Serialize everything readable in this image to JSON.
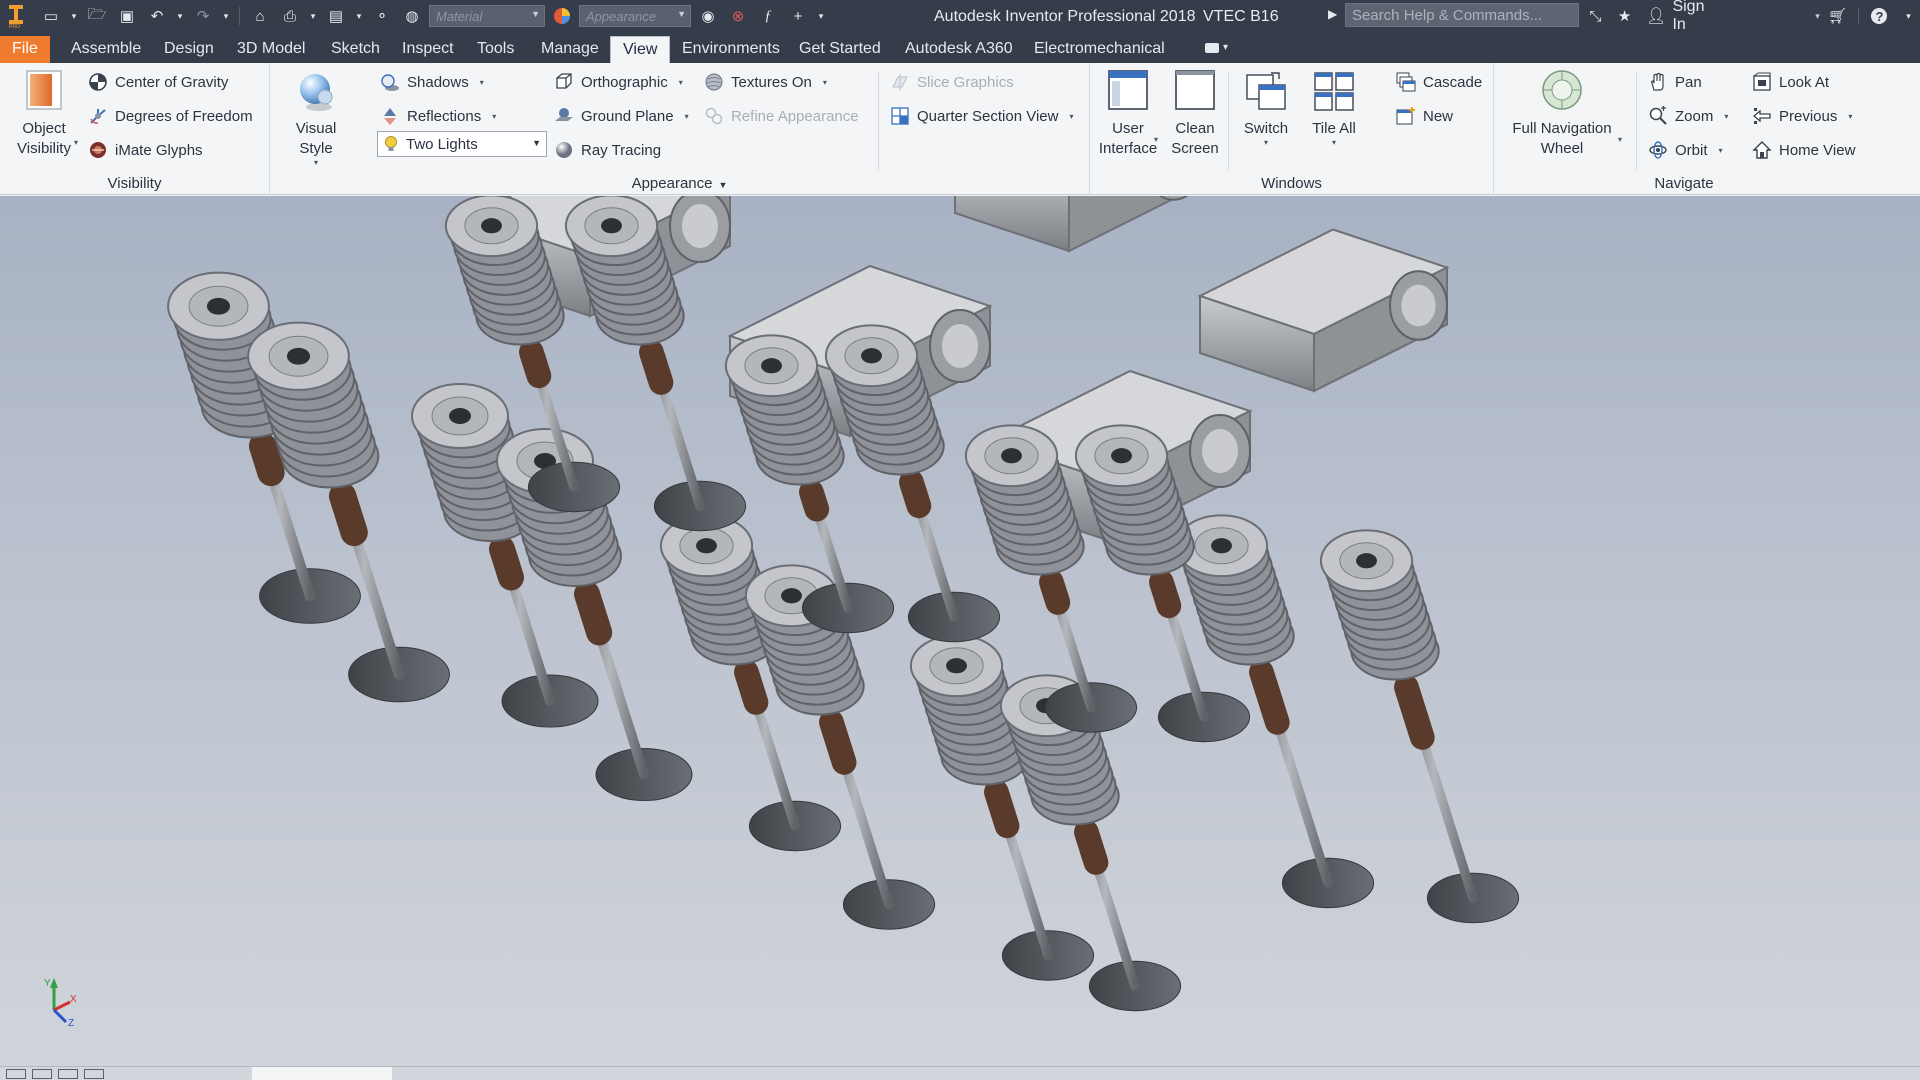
{
  "window": {
    "app_title": "Autodesk Inventor Professional 2018",
    "document_title": "VTEC B16",
    "search_placeholder": "Search Help & Commands...",
    "sign_in": "Sign In"
  },
  "qat": {
    "material_placeholder": "Material",
    "appearance_placeholder": "Appearance"
  },
  "tabs": [
    {
      "label": "File"
    },
    {
      "label": "Assemble"
    },
    {
      "label": "Design"
    },
    {
      "label": "3D Model"
    },
    {
      "label": "Sketch"
    },
    {
      "label": "Inspect"
    },
    {
      "label": "Tools"
    },
    {
      "label": "Manage"
    },
    {
      "label": "View"
    },
    {
      "label": "Environments"
    },
    {
      "label": "Get Started"
    },
    {
      "label": "Autodesk A360"
    },
    {
      "label": "Electromechanical"
    }
  ],
  "ribbon": {
    "visibility": {
      "title": "Visibility",
      "object_visibility": "Object Visibility",
      "center_of_gravity": "Center of Gravity",
      "degrees_of_freedom": "Degrees of Freedom",
      "imate_glyphs": "iMate Glyphs"
    },
    "appearance": {
      "title": "Appearance",
      "visual_style": "Visual Style",
      "shadows": "Shadows",
      "reflections": "Reflections",
      "lighting": "Two Lights",
      "orthographic": "Orthographic",
      "ground_plane": "Ground Plane",
      "ray_tracing": "Ray Tracing",
      "textures_on": "Textures On",
      "refine_appearance": "Refine Appearance",
      "slice_graphics": "Slice Graphics",
      "quarter_section_view": "Quarter Section View"
    },
    "windows": {
      "title": "Windows",
      "user_interface": "User Interface",
      "clean_screen": "Clean Screen",
      "switch": "Switch",
      "tile_all": "Tile All",
      "cascade": "Cascade",
      "new": "New"
    },
    "navigate": {
      "title": "Navigate",
      "full_navigation_wheel": "Full Navigation Wheel",
      "pan": "Pan",
      "zoom": "Zoom",
      "orbit": "Orbit",
      "look_at": "Look At",
      "previous": "Previous",
      "home_view": "Home View"
    }
  },
  "colors": {
    "titlebar": "#353d4a",
    "file_tab": "#ef7b2e",
    "ribbon_bg": "#f4f5f7",
    "viewport_top": "#a8b2c4",
    "viewport_bottom": "#d0d4da",
    "spring": "#9a9ca3",
    "valve_stem": "#5a3a2a",
    "valve_head": "#4e5257"
  },
  "triad": {
    "x": "X",
    "y": "Y",
    "z": "Z"
  }
}
